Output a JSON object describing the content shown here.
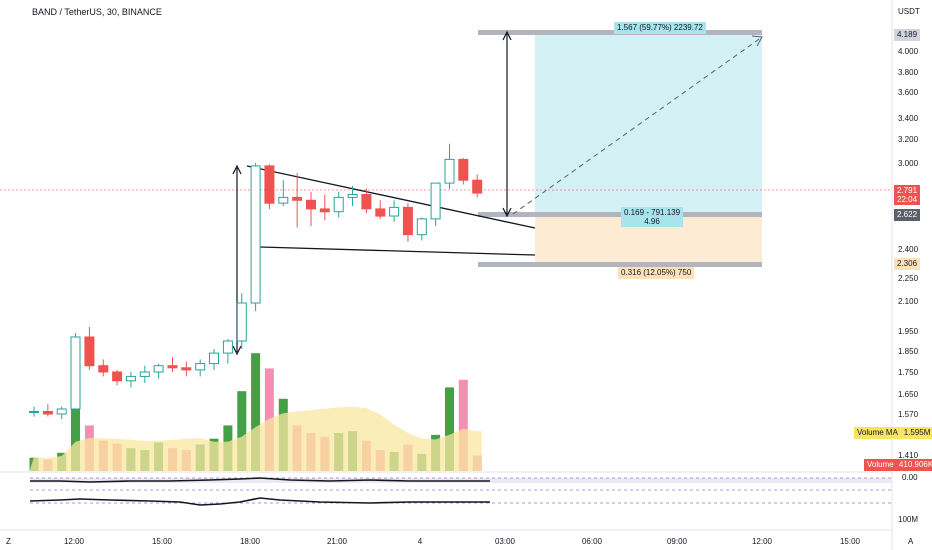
{
  "header": {
    "symbol_line": "BAND / TetherUS, 30, BINANCE",
    "currency": "USDT"
  },
  "price_axis": {
    "ticks": [
      "4.000",
      "3.800",
      "3.600",
      "3.400",
      "3.200",
      "3.000",
      "2.400",
      "2.250",
      "2.100",
      "1.950",
      "1.850",
      "1.750",
      "1.650",
      "1.570",
      "1.410"
    ],
    "badges": {
      "target": "4.189",
      "last_price": "2.791",
      "countdown": "22:04",
      "entry": "2.622",
      "stop": "2.306",
      "volume_ma_label": "Volume MA",
      "volume_ma_value": "1.595M",
      "volume_label": "Volume",
      "volume_value": "410.906K"
    }
  },
  "osc_axis": {
    "ticks": [
      "0.00",
      "100M"
    ]
  },
  "time_axis": {
    "ticks": [
      "12:00",
      "15:00",
      "18:00",
      "21:00",
      "4",
      "03:00",
      "06:00",
      "09:00",
      "12:00",
      "15:00"
    ]
  },
  "position_tool": {
    "target_label": "1.567 (59.77%) 2239.72",
    "entry_label_line1": "0.169 - 791.139",
    "entry_label_line2": "4.96",
    "stop_label": "0.316 (12.05%) 750"
  },
  "corner_icons": {
    "left": "Z",
    "right": "A"
  },
  "colors": {
    "up": "#26a69a",
    "down": "#ef5350",
    "vol_up": "#43a047",
    "vol_down": "#f48fb1",
    "target_zone": "#d4f1f6",
    "stop_zone": "#fdebd3",
    "volume_ma": "#f9e79f"
  },
  "chart_data": {
    "type": "candlestick",
    "timeframe": "30",
    "exchange": "BINANCE",
    "x": [
      "10:30",
      "11:00",
      "11:30",
      "12:00",
      "12:30",
      "13:00",
      "13:30",
      "14:00",
      "14:30",
      "15:00",
      "15:30",
      "16:00",
      "16:30",
      "17:00",
      "17:30",
      "18:00",
      "18:30",
      "19:00",
      "19:30",
      "20:00",
      "20:30",
      "21:00",
      "21:30",
      "22:00",
      "22:30",
      "23:00",
      "23:30",
      "00:00",
      "00:30",
      "01:00",
      "01:30",
      "02:00",
      "02:30"
    ],
    "ohlc": [
      [
        1.58,
        1.6,
        1.56,
        1.58
      ],
      [
        1.58,
        1.61,
        1.56,
        1.57
      ],
      [
        1.57,
        1.6,
        1.55,
        1.59
      ],
      [
        1.59,
        1.94,
        1.58,
        1.92
      ],
      [
        1.92,
        1.97,
        1.76,
        1.78
      ],
      [
        1.78,
        1.81,
        1.73,
        1.75
      ],
      [
        1.75,
        1.76,
        1.69,
        1.71
      ],
      [
        1.71,
        1.75,
        1.68,
        1.73
      ],
      [
        1.73,
        1.78,
        1.7,
        1.75
      ],
      [
        1.75,
        1.79,
        1.72,
        1.78
      ],
      [
        1.78,
        1.82,
        1.75,
        1.77
      ],
      [
        1.77,
        1.8,
        1.73,
        1.76
      ],
      [
        1.76,
        1.81,
        1.73,
        1.79
      ],
      [
        1.79,
        1.86,
        1.76,
        1.84
      ],
      [
        1.84,
        1.91,
        1.79,
        1.9
      ],
      [
        1.9,
        2.15,
        1.86,
        2.09
      ],
      [
        2.09,
        3.0,
        2.05,
        2.98
      ],
      [
        2.98,
        2.99,
        2.68,
        2.72
      ],
      [
        2.72,
        2.88,
        2.7,
        2.76
      ],
      [
        2.76,
        2.93,
        2.55,
        2.74
      ],
      [
        2.74,
        2.8,
        2.56,
        2.68
      ],
      [
        2.68,
        2.78,
        2.6,
        2.66
      ],
      [
        2.66,
        2.8,
        2.62,
        2.76
      ],
      [
        2.76,
        2.84,
        2.7,
        2.78
      ],
      [
        2.78,
        2.82,
        2.65,
        2.68
      ],
      [
        2.68,
        2.74,
        2.61,
        2.63
      ],
      [
        2.63,
        2.74,
        2.59,
        2.69
      ],
      [
        2.69,
        2.72,
        2.45,
        2.5
      ],
      [
        2.5,
        2.62,
        2.46,
        2.61
      ],
      [
        2.61,
        2.81,
        2.56,
        2.86
      ],
      [
        2.86,
        3.16,
        2.82,
        3.03
      ],
      [
        3.03,
        3.04,
        2.85,
        2.88
      ],
      [
        2.88,
        2.92,
        2.76,
        2.79
      ]
    ],
    "volume": [
      0.35,
      0.3,
      0.48,
      1.8,
      1.2,
      0.8,
      0.72,
      0.6,
      0.55,
      0.75,
      0.6,
      0.55,
      0.7,
      0.85,
      1.2,
      2.1,
      3.1,
      2.7,
      1.9,
      1.2,
      1.0,
      0.9,
      1.0,
      1.05,
      0.8,
      0.55,
      0.5,
      0.7,
      0.45,
      0.95,
      2.2,
      2.4,
      0.41
    ],
    "volume_unit": "M",
    "volume_ma_last": 1.595,
    "position": {
      "target": 4.189,
      "entry": 2.622,
      "stop": 2.306,
      "last": 2.791
    },
    "ylim": [
      1.41,
      4.2
    ]
  }
}
